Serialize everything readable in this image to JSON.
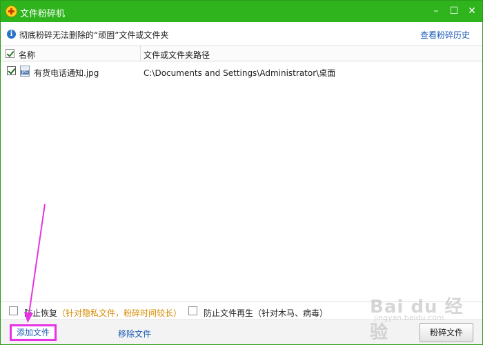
{
  "window": {
    "title": "文件粉碎机",
    "controls": {
      "minimize": "–",
      "maximize": "☐",
      "close": "✕"
    }
  },
  "infobar": {
    "icon": "info-icon",
    "text": "彻底粉碎无法删除的“顽固”文件或文件夹",
    "history_link": "查看粉碎历史"
  },
  "list": {
    "columns": [
      "名称",
      "文件或文件夹路径"
    ],
    "header_checked": true,
    "rows": [
      {
        "checked": true,
        "name": "有货电话通知.jpg",
        "path": "C:\\Documents and Settings\\Administrator\\桌面"
      }
    ]
  },
  "options": {
    "prevent_recovery": {
      "checked": false,
      "label": "防止恢复",
      "hint": "（针对隐私文件，粉碎时间较长）"
    },
    "prevent_regeneration": {
      "checked": false,
      "label": "防止文件再生",
      "hint": "（针对木马、病毒）"
    }
  },
  "footer": {
    "add_file": "添加文件",
    "remove_file": "移除文件",
    "shred_file": "粉碎文件"
  },
  "colors": {
    "titlebar": "#2fb41e",
    "link": "#1a59b3",
    "hint": "#d88a00",
    "annotation": "#e533e5"
  },
  "watermark": {
    "main": "Bai du 经验",
    "sub": "jingyan.baidu.com"
  }
}
